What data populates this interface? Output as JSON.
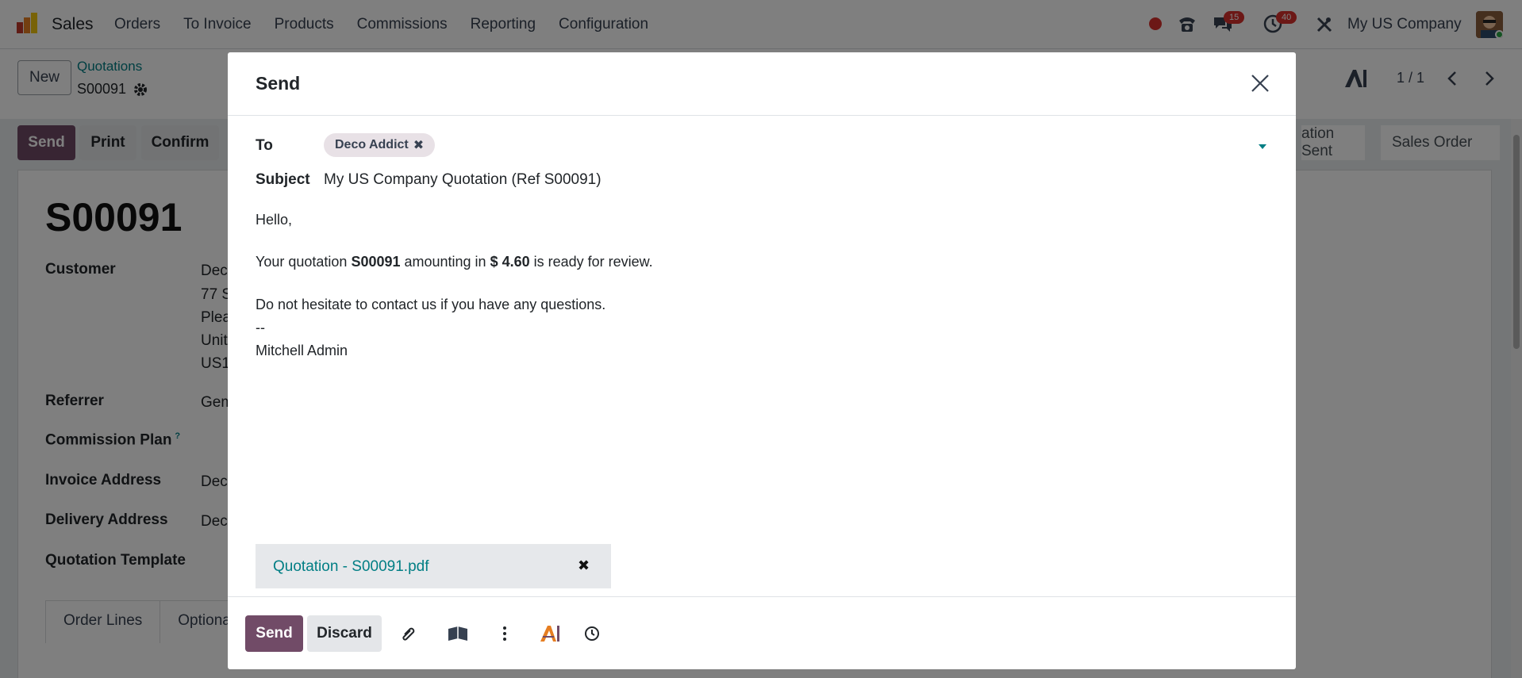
{
  "app": {
    "name": "Sales",
    "menu": [
      "Orders",
      "To Invoice",
      "Products",
      "Commissions",
      "Reporting",
      "Configuration"
    ],
    "messages_badge": "15",
    "activities_badge": "40",
    "company": "My US Company"
  },
  "control_panel": {
    "new_label": "New",
    "breadcrumb_parent": "Quotations",
    "breadcrumb_current": "S00091",
    "pager": "1 / 1"
  },
  "action_bar": {
    "send": "Send",
    "print": "Print",
    "confirm": "Confirm",
    "status_sent": "ation Sent",
    "status_sales_order": "Sales Order"
  },
  "form": {
    "title": "S00091",
    "customer_label": "Customer",
    "customer_lines": [
      "Deco",
      "77 S",
      "Plea",
      "Unit",
      "US1"
    ],
    "referrer_label": "Referrer",
    "referrer_value": "Gem",
    "commission_plan_label": "Commission Plan",
    "commission_plan_help": "?",
    "invoice_address_label": "Invoice Address",
    "invoice_address_value": "Deco",
    "delivery_address_label": "Delivery Address",
    "delivery_address_value": "Deco",
    "quotation_template_label": "Quotation Template",
    "tabs": [
      "Order Lines",
      "Optiona"
    ]
  },
  "modal": {
    "title": "Send",
    "to_label": "To",
    "recipient": "Deco Addict",
    "subject_label": "Subject",
    "subject": "My US Company Quotation (Ref S00091)",
    "body": {
      "greeting": "Hello,",
      "line1_pre": "Your quotation ",
      "line1_ref": "S00091",
      "line1_mid": " amounting in ",
      "line1_amount": "$ 4.60",
      "line1_post": " is ready for review.",
      "line2": "Do not hesitate to contact us if you have any questions.",
      "separator": "--",
      "signature": "Mitchell Admin"
    },
    "attachment": "Quotation - S00091.pdf",
    "footer": {
      "send": "Send",
      "discard": "Discard"
    }
  },
  "colors": {
    "brand": "#714b67",
    "link": "#017e84",
    "badge": "#d9302c"
  }
}
